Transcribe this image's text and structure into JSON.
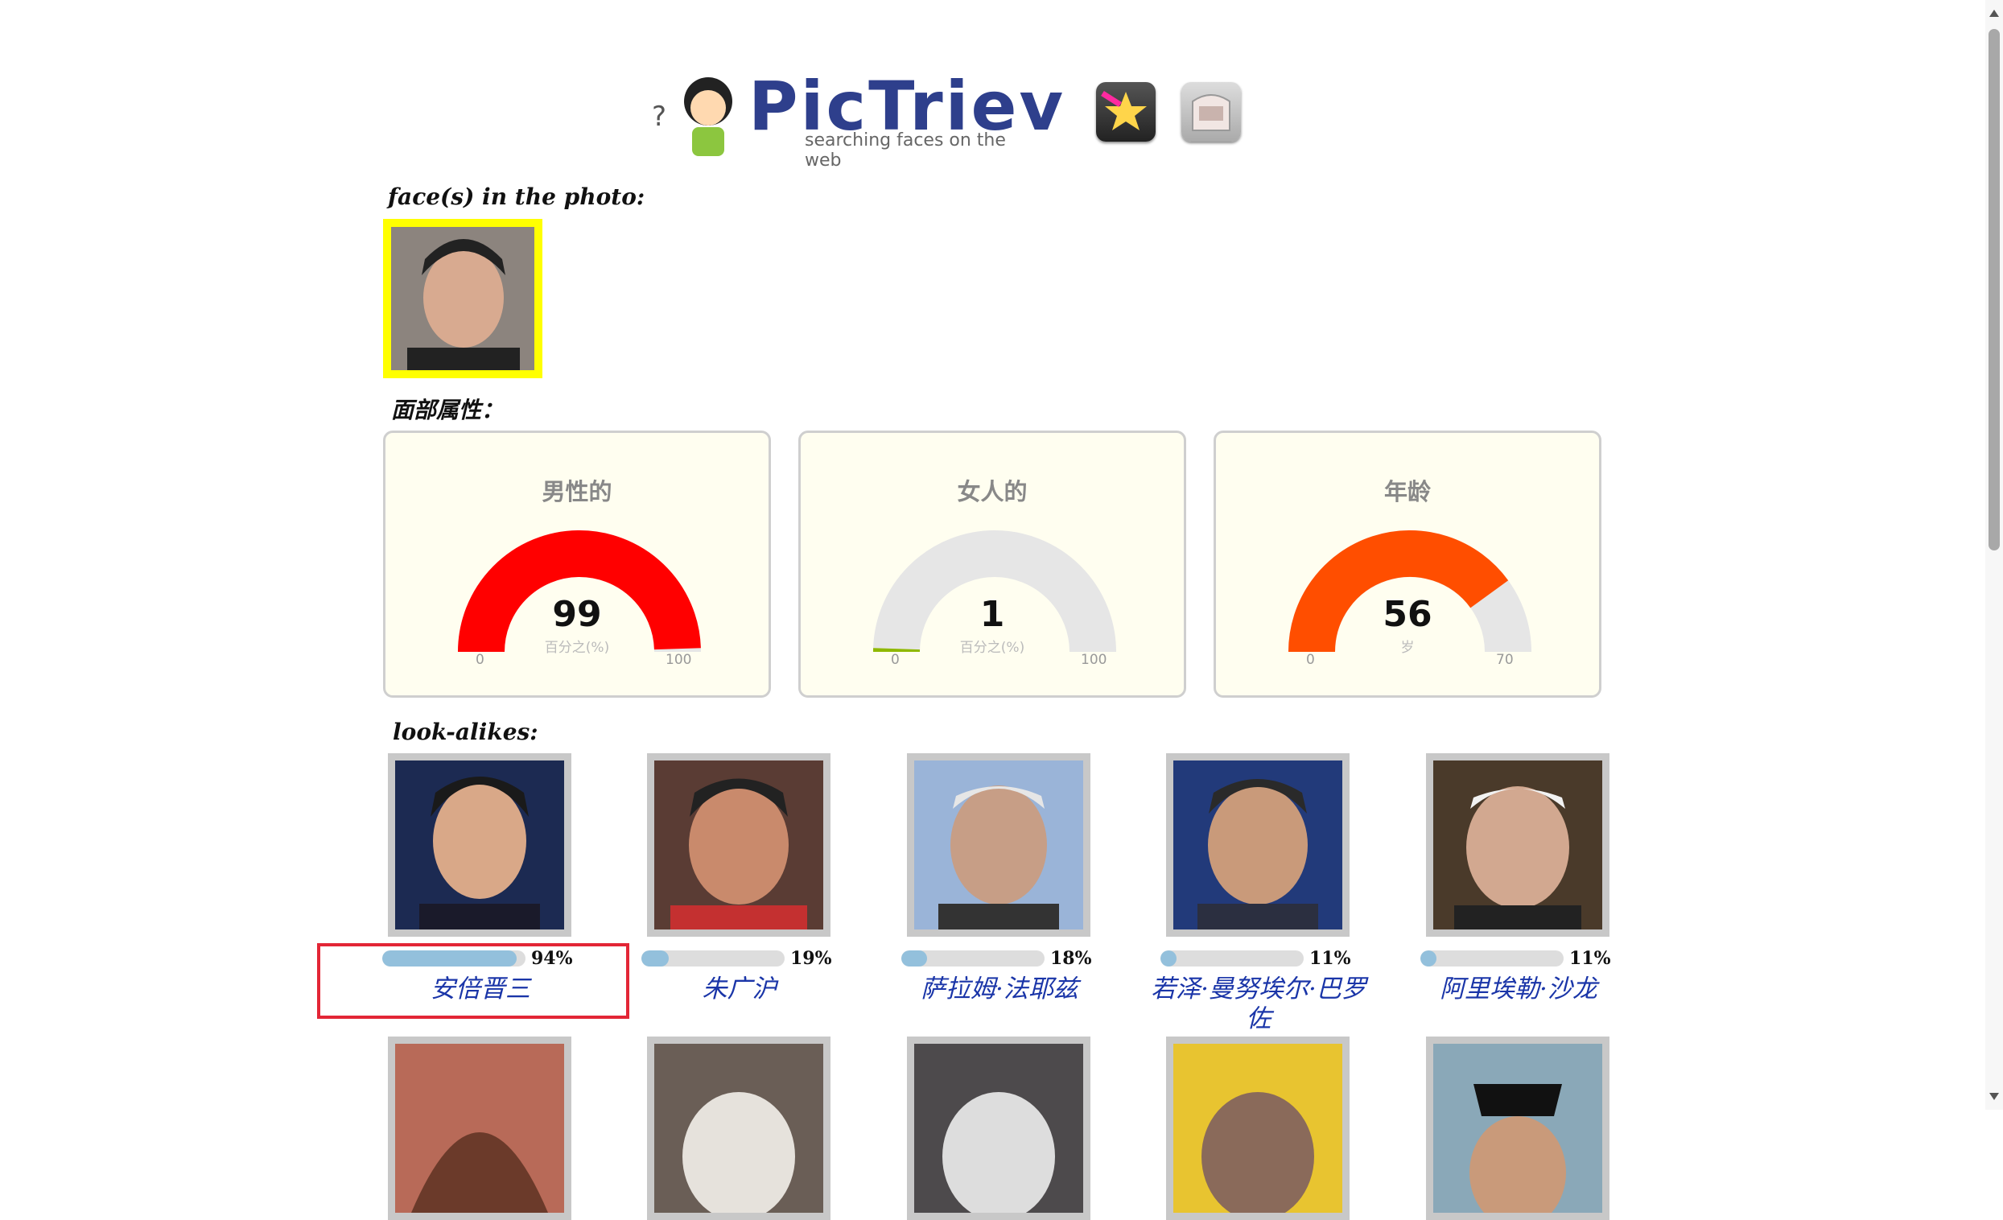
{
  "header": {
    "logo_title": "PicTriev",
    "logo_subtitle": "searching faces on the web",
    "buttons": [
      {
        "icon": "star-icon"
      },
      {
        "icon": "room-icon"
      }
    ]
  },
  "sections": {
    "faces_title": "face(s) in the photo:",
    "attributes_title": "面部属性：",
    "lookalikes_title": "look-alikes:"
  },
  "gauges": [
    {
      "title": "男性的",
      "value": "99",
      "unit": "百分之(%)",
      "min": "0",
      "max": "100",
      "fraction": 0.99,
      "color": "#ff0000"
    },
    {
      "title": "女人的",
      "value": "1",
      "unit": "百分之(%)",
      "min": "0",
      "max": "100",
      "fraction": 0.01,
      "color": "#8fb800"
    },
    {
      "title": "年龄",
      "value": "56",
      "unit": "岁",
      "min": "0",
      "max": "70",
      "fraction": 0.8,
      "color": "#ff4e00"
    }
  ],
  "lookalikes": [
    {
      "name": "安倍晋三",
      "percent": "94%",
      "fraction": 0.94
    },
    {
      "name": "朱广沪",
      "percent": "19%",
      "fraction": 0.19
    },
    {
      "name": "萨拉姆·法耶兹",
      "percent": "18%",
      "fraction": 0.18
    },
    {
      "name": "若泽·曼努埃尔·巴罗佐",
      "percent": "11%",
      "fraction": 0.11
    },
    {
      "name": "阿里埃勒·沙龙",
      "percent": "11%",
      "fraction": 0.11
    }
  ]
}
